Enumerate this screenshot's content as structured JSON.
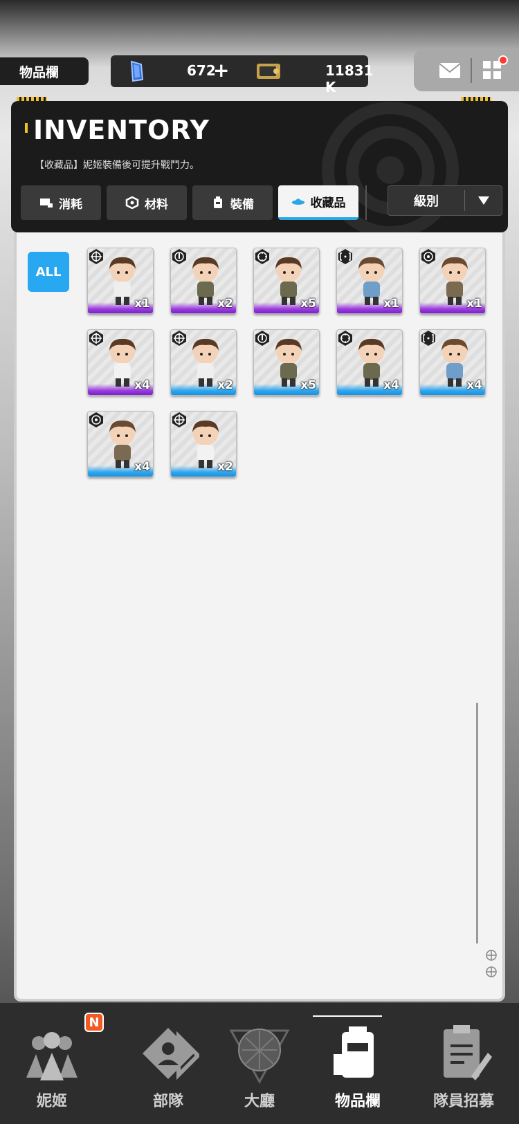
{
  "top_bar": {
    "page_label": "物品欄",
    "gem_value": "672",
    "gem_add": "+",
    "gold_value": "11831 K",
    "has_notification": true
  },
  "header": {
    "title": "INVENTORY",
    "subtitle": "【收藏品】妮姬裝備後可提升戰鬥力。",
    "tabs": [
      {
        "label": "消耗",
        "icon": "consumable-icon",
        "active": false
      },
      {
        "label": "材料",
        "icon": "material-icon",
        "active": false
      },
      {
        "label": "裝備",
        "icon": "equipment-icon",
        "active": false
      },
      {
        "label": "收藏品",
        "icon": "collection-icon",
        "active": true
      }
    ],
    "sort_label": "級別"
  },
  "filter": {
    "all_label": "ALL"
  },
  "items": [
    {
      "qty": "x1",
      "rarity": "purple",
      "badge": "crosshair-icon",
      "pose": "sleep"
    },
    {
      "qty": "x2",
      "rarity": "purple",
      "badge": "drop-icon",
      "pose": "stand"
    },
    {
      "qty": "x5",
      "rarity": "purple",
      "badge": "target-icon",
      "pose": "stand"
    },
    {
      "qty": "x1",
      "rarity": "purple",
      "badge": "bracket-icon",
      "pose": "blue"
    },
    {
      "qty": "x1",
      "rarity": "purple",
      "badge": "circle-dot-icon",
      "pose": "wink"
    },
    {
      "qty": "x4",
      "rarity": "purple",
      "badge": "crosshair-icon",
      "pose": "white"
    },
    {
      "qty": "x2",
      "rarity": "blue",
      "badge": "crosshair-icon",
      "pose": "sleep"
    },
    {
      "qty": "x5",
      "rarity": "blue",
      "badge": "drop-icon",
      "pose": "stand"
    },
    {
      "qty": "x4",
      "rarity": "blue",
      "badge": "target-icon",
      "pose": "stand"
    },
    {
      "qty": "x4",
      "rarity": "blue",
      "badge": "bracket-icon",
      "pose": "blue"
    },
    {
      "qty": "x4",
      "rarity": "blue",
      "badge": "circle-dot-icon",
      "pose": "wink"
    },
    {
      "qty": "x2",
      "rarity": "blue",
      "badge": "crosshair-icon",
      "pose": "white"
    }
  ],
  "nav": [
    {
      "label": "妮姬",
      "icon": "nikke-icon",
      "badge": "N",
      "active": false
    },
    {
      "label": "部隊",
      "icon": "squad-icon",
      "active": false
    },
    {
      "label": "大廳",
      "icon": "lobby-icon",
      "active": false
    },
    {
      "label": "物品欄",
      "icon": "inventory-icon",
      "active": true
    },
    {
      "label": "隊員招募",
      "icon": "recruit-icon",
      "active": false
    }
  ],
  "colors": {
    "accent_blue": "#27a8f0",
    "rarity_purple": "#9b3de0",
    "rarity_blue": "#2ea8ef",
    "notification": "#ff3b2f"
  }
}
